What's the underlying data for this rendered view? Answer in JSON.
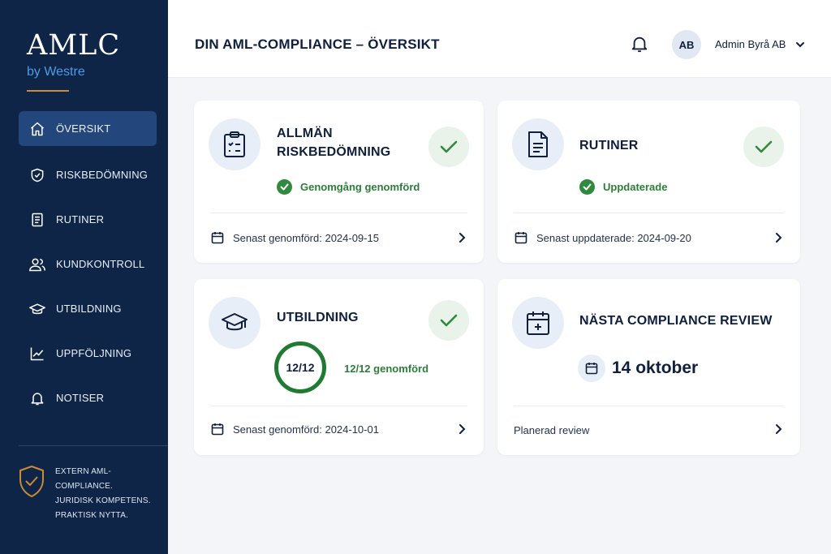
{
  "brand": {
    "name": "AMLC",
    "sub": "by Westre"
  },
  "nav": [
    {
      "label": "ÖVERSIKT",
      "icon": "home-icon"
    },
    {
      "label": "RISKBEDÖMNING",
      "icon": "shield-check-icon"
    },
    {
      "label": "RUTINER",
      "icon": "document-icon"
    },
    {
      "label": "KUNDKONTROLL",
      "icon": "users-icon"
    },
    {
      "label": "UTBILDNING",
      "icon": "graduation-cap-icon"
    },
    {
      "label": "UPPFÖLJNING",
      "icon": "chart-line-icon"
    },
    {
      "label": "NOTISER",
      "icon": "bell-icon"
    }
  ],
  "sidebar_footer": {
    "lines": [
      "EXTERN AML-COMPLIANCE.",
      "JURIDISK KOMPETENS.",
      "PRAKTISK NYTTA."
    ]
  },
  "header": {
    "title": "DIN AML-COMPLIANCE – ÖVERSIKT",
    "avatar_initials": "AB",
    "user_name": "Admin Byrå AB"
  },
  "cards": {
    "risk": {
      "title_line1": "ALLMÄN",
      "title_line2": "RISKBEDÖMNING",
      "status": "Genomgång genomförd",
      "footer": "Senast genomförd: 2024-09-15"
    },
    "rutiner": {
      "title": "RUTINER",
      "status": "Uppdaterade",
      "footer": "Senast uppdaterade: 2024-09-20"
    },
    "utbildning": {
      "title": "UTBILDNING",
      "progress": "12/12",
      "progress_text": "12/12 genomförd",
      "footer": "Senast genomförd: 2024-10-01"
    },
    "review": {
      "title": "NÄSTA COMPLIANCE REVIEW",
      "date": "14 oktober",
      "footer": "Planerad review"
    }
  },
  "colors": {
    "sidebar": "#0e2548",
    "active": "#23467c",
    "accent_green": "#2f8a3d",
    "brand_blue": "#4b9be8",
    "brand_gold": "#c98c35"
  }
}
